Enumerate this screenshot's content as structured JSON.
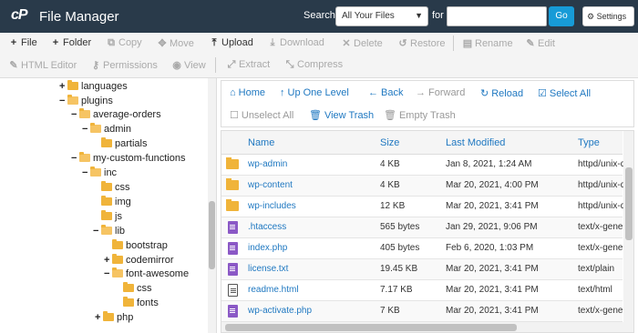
{
  "header": {
    "title": "File Manager",
    "search_label": "Search",
    "search_scope": "All Your Files",
    "for_label": "for",
    "search_value": "",
    "go_label": "Go",
    "settings_label": "Settings"
  },
  "toolbar": {
    "file": "File",
    "folder": "Folder",
    "copy": "Copy",
    "move": "Move",
    "upload": "Upload",
    "download": "Download",
    "delete": "Delete",
    "restore": "Restore",
    "rename": "Rename",
    "edit": "Edit",
    "html_editor": "HTML Editor",
    "permissions": "Permissions",
    "view": "View",
    "extract": "Extract",
    "compress": "Compress"
  },
  "tree": [
    {
      "label": "languages",
      "toggle": "+"
    },
    {
      "label": "plugins",
      "toggle": "−"
    },
    {
      "label": "average-orders",
      "toggle": "−"
    },
    {
      "label": "admin",
      "toggle": "−"
    },
    {
      "label": "partials",
      "toggle": ""
    },
    {
      "label": "my-custom-functions",
      "toggle": "−"
    },
    {
      "label": "inc",
      "toggle": "−"
    },
    {
      "label": "css",
      "toggle": ""
    },
    {
      "label": "img",
      "toggle": ""
    },
    {
      "label": "js",
      "toggle": ""
    },
    {
      "label": "lib",
      "toggle": "−"
    },
    {
      "label": "bootstrap",
      "toggle": ""
    },
    {
      "label": "codemirror",
      "toggle": "+"
    },
    {
      "label": "font-awesome",
      "toggle": "−"
    },
    {
      "label": "css",
      "toggle": ""
    },
    {
      "label": "fonts",
      "toggle": ""
    },
    {
      "label": "php",
      "toggle": "+"
    }
  ],
  "actions": {
    "home": "Home",
    "up": "Up One Level",
    "back": "Back",
    "forward": "Forward",
    "reload": "Reload",
    "select_all": "Select All",
    "unselect_all": "Unselect All",
    "view_trash": "View Trash",
    "empty_trash": "Empty Trash"
  },
  "table": {
    "columns": [
      "Name",
      "Size",
      "Last Modified",
      "Type"
    ],
    "rows": [
      {
        "icon": "folder",
        "name": "wp-admin",
        "size": "4 KB",
        "modified": "Jan 8, 2021, 1:24 AM",
        "type": "httpd/unix-d"
      },
      {
        "icon": "folder",
        "name": "wp-content",
        "size": "4 KB",
        "modified": "Mar 20, 2021, 4:00 PM",
        "type": "httpd/unix-d"
      },
      {
        "icon": "folder",
        "name": "wp-includes",
        "size": "12 KB",
        "modified": "Mar 20, 2021, 3:41 PM",
        "type": "httpd/unix-d"
      },
      {
        "icon": "doc",
        "name": ".htaccess",
        "size": "565 bytes",
        "modified": "Jan 29, 2021, 9:06 PM",
        "type": "text/x-gener"
      },
      {
        "icon": "doc",
        "name": "index.php",
        "size": "405 bytes",
        "modified": "Feb 6, 2020, 1:03 PM",
        "type": "text/x-gener"
      },
      {
        "icon": "doc",
        "name": "license.txt",
        "size": "19.45 KB",
        "modified": "Mar 20, 2021, 3:41 PM",
        "type": "text/plain"
      },
      {
        "icon": "html",
        "name": "readme.html",
        "size": "7.17 KB",
        "modified": "Mar 20, 2021, 3:41 PM",
        "type": "text/html"
      },
      {
        "icon": "doc",
        "name": "wp-activate.php",
        "size": "7 KB",
        "modified": "Mar 20, 2021, 3:41 PM",
        "type": "text/x-gener"
      }
    ]
  }
}
